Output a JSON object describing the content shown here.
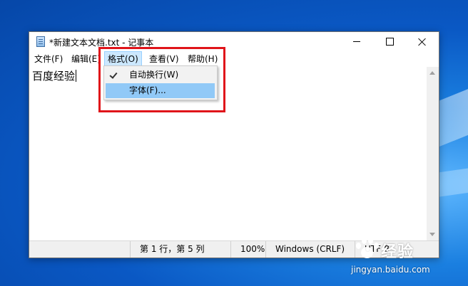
{
  "window": {
    "title": "*新建文本文档.txt - 记事本"
  },
  "menu": {
    "file": "文件(F)",
    "edit": "编辑(E)",
    "format": "格式(O)",
    "view": "查看(V)",
    "help": "帮助(H)"
  },
  "format_menu": {
    "items": [
      {
        "label": "自动换行(W)",
        "checked": true
      },
      {
        "label": "字体(F)...",
        "checked": false
      }
    ]
  },
  "editor": {
    "text": "百度经验"
  },
  "status": {
    "position": "第 1 行，第 5 列",
    "zoom": "100%",
    "line_ending": "Windows (CRLF)",
    "encoding": "UTF-8"
  },
  "watermark": {
    "brand": "经验",
    "url": "jingyan.baidu.com"
  },
  "colors": {
    "highlight": "#e0141a",
    "menu_selected": "#cce8ff",
    "item_hover": "#91c9f7"
  }
}
